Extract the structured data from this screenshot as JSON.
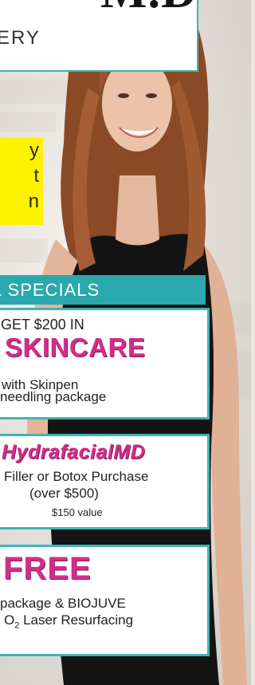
{
  "header": {
    "title_fragment": "M.D",
    "subtitle_fragment": "ERY"
  },
  "callout": {
    "lines": [
      "y",
      "t",
      "n"
    ]
  },
  "specials": {
    "label": "L SPECIALS"
  },
  "offers": [
    {
      "line1": "GET $200 IN",
      "headline": "SKINCARE",
      "line3": "with Skinpen",
      "line4": "needling package"
    },
    {
      "headline": "HydrafacialMD",
      "line2": "Filler or Botox Purchase",
      "line3": "(over $500)",
      "value_note": "$150 value"
    },
    {
      "headline": "FREE",
      "line2": "package & BIOJUVE",
      "line3_prefix": "O",
      "line3_sub": "2",
      "line3_suffix": " Laser Resurfacing"
    }
  ],
  "colors": {
    "teal": "#2aa8ad",
    "magenta": "#d22d8c",
    "yellow": "#fff200"
  }
}
